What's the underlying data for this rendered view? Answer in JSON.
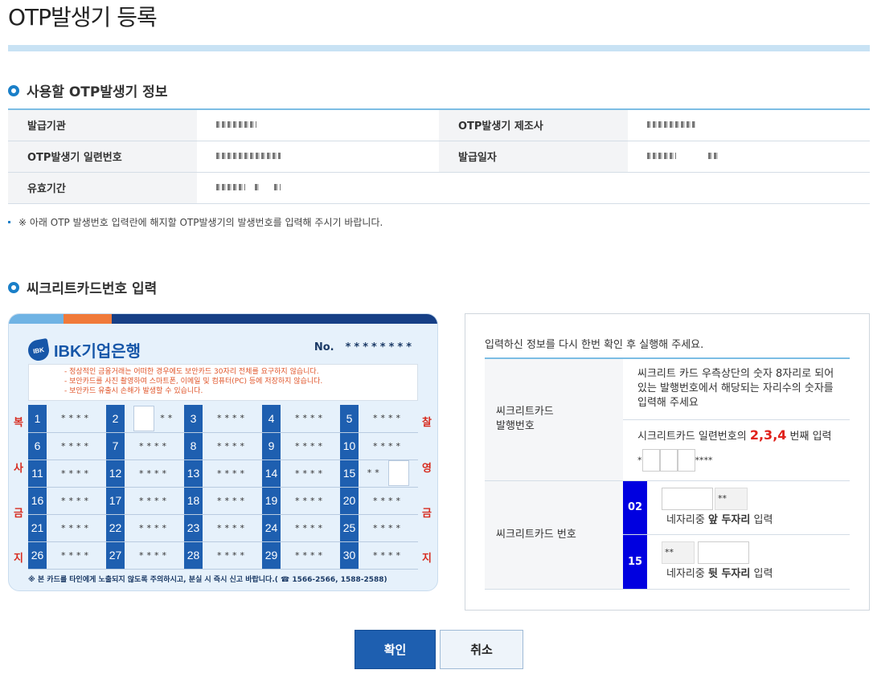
{
  "page_title": "OTP발생기 등록",
  "otp_section": {
    "heading": "사용할 OTP발생기 정보",
    "rows": [
      {
        "label1": "발급기관",
        "label2": "OTP발생기 제조사"
      },
      {
        "label1": "OTP발생기 일련번호",
        "label2": "발급일자"
      },
      {
        "label1": "유효기간"
      }
    ]
  },
  "notice": "※ 아래 OTP 발생번호 입력란에 해지할 OTP발생기의 발생번호를 입력해 주시기 바랍니다.",
  "card_section": {
    "heading": "씨크리트카드번호 입력"
  },
  "card": {
    "bank_name": "IBK기업은행",
    "logo_mark": "IBK",
    "serial_label": "No.",
    "serial_mask": "********",
    "warnings": [
      "- 정상적인 금융거래는 어떠한 경우에도 보안카드 30자리 전체를 요구하지 않습니다.",
      "- 보안카드를 사진 촬영하여 스마트폰, 이메일 및 컴퓨터(PC) 등에 저장하지 않습니다.",
      "- 보안카드 유출시 손해가 발생할 수 있습니다."
    ],
    "cell_mask": "****",
    "partial_mask": "**",
    "side_left": [
      "복",
      "사",
      "금",
      "지"
    ],
    "side_right": [
      "찰",
      "영",
      "금",
      "지"
    ],
    "footer": "※ 본 카드를 타인에게 노출되지 않도록 주의하시고, 분실 시 즉시 신고 바랍니다.( ☎ 1566-2566, 1588-2588)"
  },
  "panel": {
    "message": "입력하신 정보를 다시 한번 확인 후 실행해 주세요.",
    "issue_label_line1": "씨크리트카드",
    "issue_label_line2": "발행번호",
    "issue_desc": "씨크리트 카드 우측상단의 숫자 8자리로 되어 있는 발행번호에서 해당되는 자리수의 숫자를 입력해 주세요",
    "issue_prompt_pre": "시크리트카드 일련번호의",
    "issue_prompt_digits": "2,3,4",
    "issue_prompt_post": "번째 입력",
    "issue_prefix": "*",
    "issue_suffix": "****",
    "card_number_label": "씨크리트카드 번호",
    "row1": {
      "badge": "02",
      "fixed": "**",
      "hint_pre": "네자리중",
      "hint_bold": "앞 두자리",
      "hint_post": "입력"
    },
    "row2": {
      "badge": "15",
      "fixed": "**",
      "hint_pre": "네자리중",
      "hint_bold": "뒷 두자리",
      "hint_post": "입력"
    }
  },
  "buttons": {
    "ok": "확인",
    "cancel": "취소"
  },
  "colors": {
    "primary": "#1e5fb0",
    "accent_bar": "#c8e2f4",
    "badge": "#0000e0",
    "highlight": "#e0201a"
  }
}
